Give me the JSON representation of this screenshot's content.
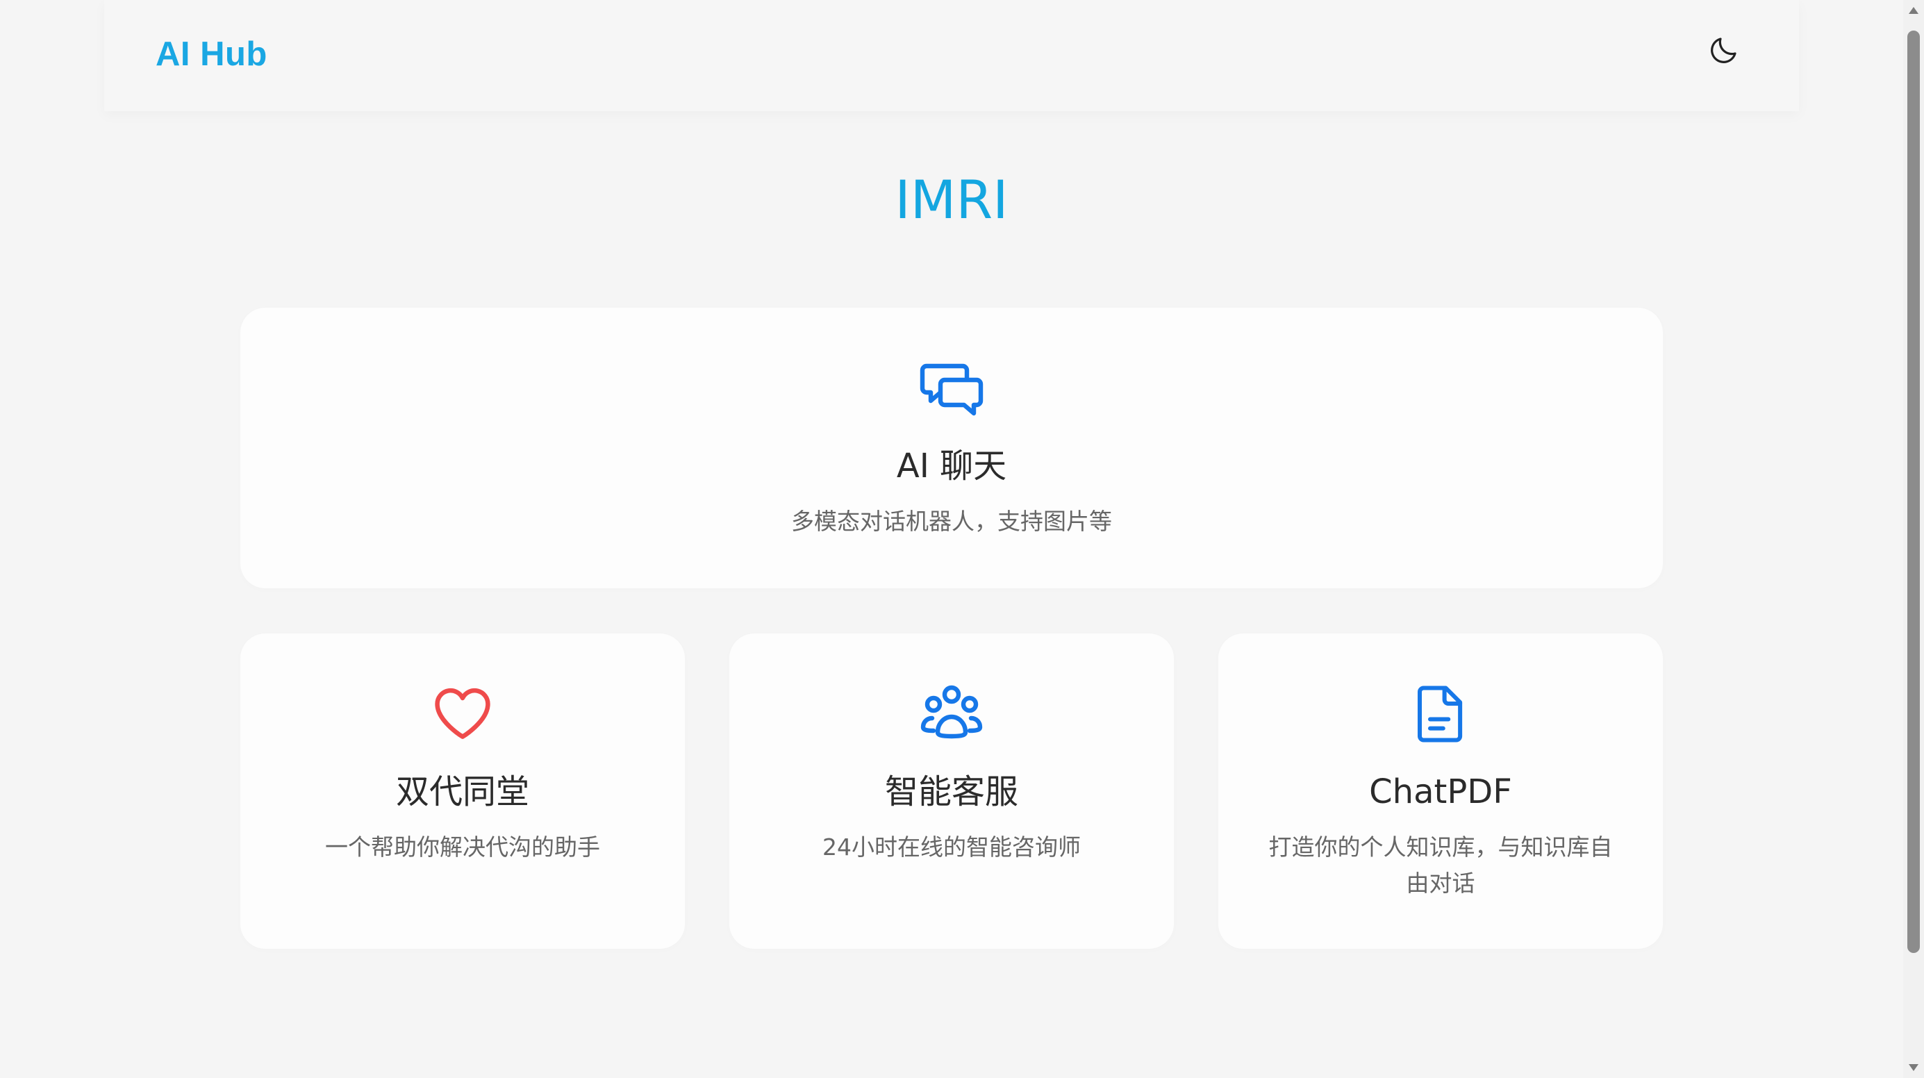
{
  "header": {
    "logo": "AI Hub",
    "theme_toggle_icon": "moon-icon"
  },
  "hero": {
    "title": "IMRI"
  },
  "cards": {
    "main": {
      "icon": "chat-bubbles-icon",
      "title": "AI 聊天",
      "desc": "多模态对话机器人，支持图片等"
    },
    "items": [
      {
        "icon": "heart-icon",
        "title": "双代同堂",
        "desc": "一个帮助你解决代沟的助手"
      },
      {
        "icon": "users-group-icon",
        "title": "智能客服",
        "desc": "24小时在线的智能咨询师"
      },
      {
        "icon": "document-icon",
        "title": "ChatPDF",
        "desc": "打造你的个人知识库，与知识库自由对话"
      }
    ]
  },
  "colors": {
    "accent": "#14a6e0",
    "icon_blue": "#1677e8",
    "heart_red": "#ef4b4b",
    "background": "#f5f5f5",
    "card": "#fdfdfd"
  }
}
